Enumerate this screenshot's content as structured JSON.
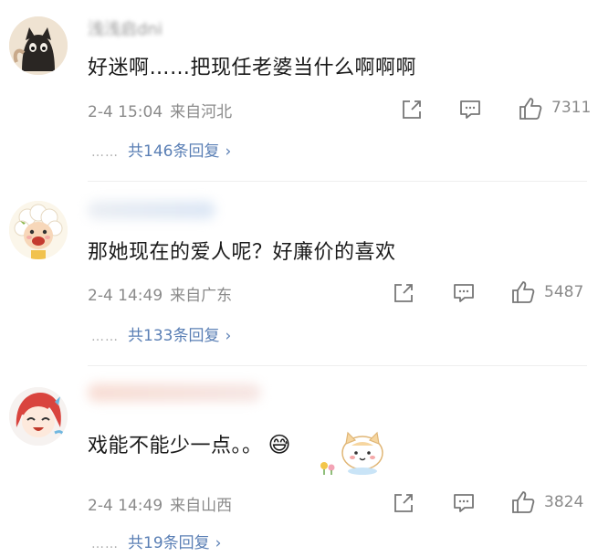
{
  "comments": [
    {
      "username": "浅浅启dni",
      "text": "好迷啊……把现任老婆当什么啊啊啊",
      "date": "2-4 15:04",
      "location": "来自河北",
      "likes": "7311",
      "dots": "……",
      "replies": "共146条回复",
      "chevron": "›"
    },
    {
      "text": "那她现在的爱人呢？好廉价的喜欢",
      "date": "2-4 14:49",
      "location": "来自广东",
      "likes": "5487",
      "dots": "……",
      "replies": "共133条回复",
      "chevron": "›"
    },
    {
      "text": "戏能不能少一点。。",
      "emoji": "😅",
      "date": "2-4 14:49",
      "location": "来自山西",
      "likes": "3824",
      "dots": "……",
      "replies": "共19条回复",
      "chevron": "›"
    }
  ],
  "icons": {
    "repost": "share-icon",
    "comment": "comment-icon",
    "like": "thumb-up-icon"
  },
  "colors": {
    "link": "#5a7fb5",
    "meta": "#8a8a8a",
    "text": "#1a1a1a"
  }
}
